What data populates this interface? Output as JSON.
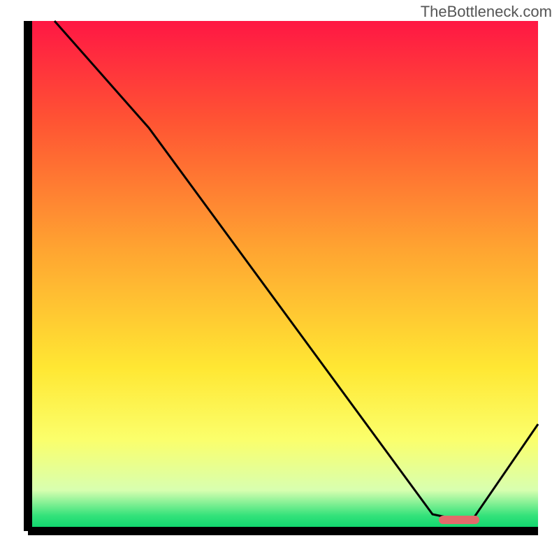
{
  "watermark": "TheBottleneck.com",
  "chart_data": {
    "type": "line",
    "title": "",
    "xlabel": "",
    "ylabel": "",
    "xlim": [
      0,
      100
    ],
    "ylim": [
      0,
      100
    ],
    "grid": false,
    "legend": false,
    "watermark": "TheBottleneck.com",
    "background_gradient": {
      "orientation": "vertical",
      "stops": [
        {
          "pos": 0.0,
          "color": "#ff1744"
        },
        {
          "pos": 0.2,
          "color": "#ff5533"
        },
        {
          "pos": 0.45,
          "color": "#ffa531"
        },
        {
          "pos": 0.68,
          "color": "#ffe733"
        },
        {
          "pos": 0.82,
          "color": "#fbff6b"
        },
        {
          "pos": 0.92,
          "color": "#d8ffb0"
        },
        {
          "pos": 0.97,
          "color": "#33e27a"
        },
        {
          "pos": 1.0,
          "color": "#05d26a"
        }
      ]
    },
    "series": [
      {
        "name": "curve",
        "color": "#000000",
        "x": [
          0.053,
          0.237,
          0.793,
          0.845,
          0.871,
          1.0
        ],
        "y": [
          1.0,
          0.79,
          0.033,
          0.022,
          0.022,
          0.21
        ]
      }
    ],
    "marker": {
      "name": "optimal-range",
      "color": "#e26a6a",
      "x_range": [
        0.8,
        0.88
      ],
      "y": 0.022,
      "height_frac": 0.017
    }
  }
}
